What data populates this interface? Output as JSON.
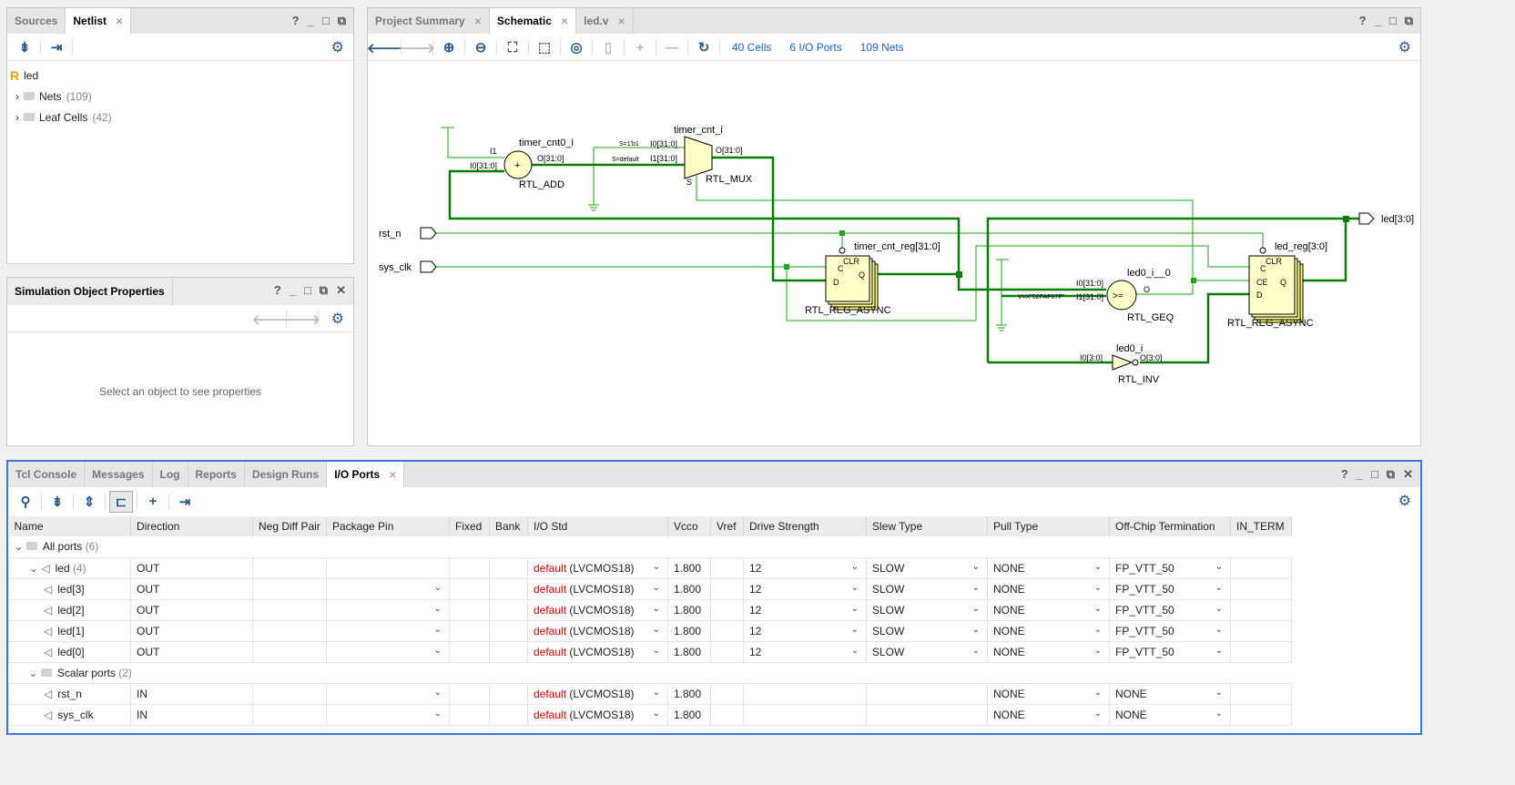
{
  "netlist_panel": {
    "tabs": [
      "Sources",
      "Netlist"
    ],
    "active_tab": "Netlist",
    "root": "led",
    "root_icon": "R",
    "items": [
      {
        "label": "Nets",
        "count": "(109)"
      },
      {
        "label": "Leaf Cells",
        "count": "(42)"
      }
    ]
  },
  "props_panel": {
    "title": "Simulation Object Properties",
    "empty_message": "Select an object to see properties"
  },
  "schematic_panel": {
    "tabs": [
      "Project Summary",
      "Schematic",
      "led.v"
    ],
    "active_tab": "Schematic",
    "stats": {
      "cells": "40 Cells",
      "ports": "6 I/O Ports",
      "nets": "109 Nets"
    },
    "labels": {
      "adder_name": "timer_cnt0_i",
      "adder_type": "RTL_ADD",
      "adder_sym": "+",
      "adder_i1": "I1",
      "adder_i0": "I0[31:0]",
      "adder_o": "O[31:0]",
      "mux_name": "timer_cnt_i",
      "mux_type": "RTL_MUX",
      "mux_i0": "I0[31:0]",
      "mux_i1": "I1[31:0]",
      "mux_o": "O[31:0]",
      "mux_s": "S",
      "mux_s1": "S=1'b1",
      "mux_sdef": "S=default",
      "reg1_name": "timer_cnt_reg[31:0]",
      "reg1_type": "RTL_REG_ASYNC",
      "clr": "CLR",
      "c": "C",
      "d": "D",
      "q": "Q",
      "ce": "CE",
      "geq_name": "led0_i__0",
      "geq_type": "RTL_GEQ",
      "geq_sym": ">=",
      "geq_i0": "I0[31:0]",
      "geq_i1": "I1[31:0]",
      "geq_o": "O",
      "const": "V=X\"02FAF07F\"",
      "reg2_name": "led_reg[3:0]",
      "reg2_type": "RTL_REG_ASYNC",
      "inv_name": "led0_i",
      "inv_type": "RTL_INV",
      "inv_i0": "I0[3:0]",
      "inv_o": "O[3:0]",
      "port_rst": "rst_n",
      "port_clk": "sys_clk",
      "port_led": "led[3:0]"
    }
  },
  "bottom_panel": {
    "tabs": [
      "Tcl Console",
      "Messages",
      "Log",
      "Reports",
      "Design Runs",
      "I/O Ports"
    ],
    "active_tab": "I/O Ports",
    "columns": [
      "Name",
      "Direction",
      "Neg Diff Pair",
      "Package Pin",
      "Fixed",
      "Bank",
      "I/O Std",
      "Vcco",
      "Vref",
      "Drive Strength",
      "Slew Type",
      "Pull Type",
      "Off-Chip Termination",
      "IN_TERM"
    ],
    "rows": [
      {
        "type": "group",
        "level": 0,
        "name": "All ports",
        "count": "(6)"
      },
      {
        "type": "bus",
        "level": 1,
        "name": "led",
        "count": "(4)",
        "direction": "OUT",
        "pkg": false,
        "iostd_default": "default",
        "iostd": "(LVCMOS18)",
        "vcco": "1.800",
        "drive": "12",
        "slew": "SLOW",
        "pull": "NONE",
        "term": "FP_VTT_50"
      },
      {
        "type": "port",
        "level": 2,
        "name": "led[3]",
        "direction": "OUT",
        "pkg": true,
        "iostd_default": "default",
        "iostd": "(LVCMOS18)",
        "vcco": "1.800",
        "drive": "12",
        "slew": "SLOW",
        "pull": "NONE",
        "term": "FP_VTT_50"
      },
      {
        "type": "port",
        "level": 2,
        "name": "led[2]",
        "direction": "OUT",
        "pkg": true,
        "iostd_default": "default",
        "iostd": "(LVCMOS18)",
        "vcco": "1.800",
        "drive": "12",
        "slew": "SLOW",
        "pull": "NONE",
        "term": "FP_VTT_50"
      },
      {
        "type": "port",
        "level": 2,
        "name": "led[1]",
        "direction": "OUT",
        "pkg": true,
        "iostd_default": "default",
        "iostd": "(LVCMOS18)",
        "vcco": "1.800",
        "drive": "12",
        "slew": "SLOW",
        "pull": "NONE",
        "term": "FP_VTT_50"
      },
      {
        "type": "port",
        "level": 2,
        "name": "led[0]",
        "direction": "OUT",
        "pkg": true,
        "iostd_default": "default",
        "iostd": "(LVCMOS18)",
        "vcco": "1.800",
        "drive": "12",
        "slew": "SLOW",
        "pull": "NONE",
        "term": "FP_VTT_50"
      },
      {
        "type": "group",
        "level": 1,
        "name": "Scalar ports",
        "count": "(2)"
      },
      {
        "type": "port",
        "level": 2,
        "name": "rst_n",
        "direction": "IN",
        "pkg": true,
        "iostd_default": "default",
        "iostd": "(LVCMOS18)",
        "vcco": "1.800",
        "drive": "",
        "slew": "",
        "pull": "NONE",
        "term": "NONE"
      },
      {
        "type": "port",
        "level": 2,
        "name": "sys_clk",
        "direction": "IN",
        "pkg": true,
        "iostd_default": "default",
        "iostd": "(LVCMOS18)",
        "vcco": "1.800",
        "drive": "",
        "slew": "",
        "pull": "NONE",
        "term": "NONE"
      }
    ]
  },
  "colors": {
    "wire": "#1aaa1a",
    "bus": "#0a7a0a",
    "cell_fill": "#ffffc8",
    "accent": "#3c78d8"
  }
}
